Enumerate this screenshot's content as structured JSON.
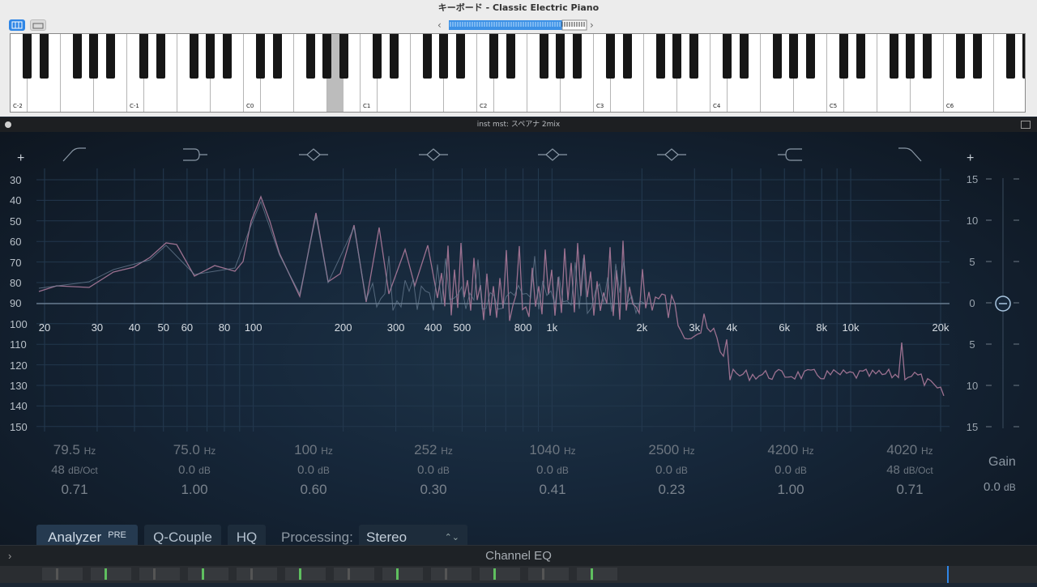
{
  "keyboard_window": {
    "title": "キーボード - Classic Electric Piano",
    "octave_labels": [
      "C-2",
      "C-1",
      "C0",
      "C1",
      "C2",
      "C3",
      "C4",
      "C5",
      "C6"
    ],
    "nav_prev": "‹",
    "nav_next": "›"
  },
  "plugin_window": {
    "title": "inst mst: スペアナ 2mix",
    "plus_left": "+",
    "plus_right": "+"
  },
  "eq": {
    "db_scale_left": [
      "30",
      "40",
      "50",
      "60",
      "70",
      "80",
      "90",
      "100",
      "110",
      "120",
      "130",
      "140",
      "150"
    ],
    "gain_scale_right": [
      "15",
      "10",
      "5",
      "0",
      "5",
      "10",
      "15"
    ],
    "freq_labels": [
      "20",
      "30",
      "40",
      "50",
      "60",
      "80",
      "100",
      "200",
      "300",
      "400",
      "500",
      "800",
      "1k",
      "2k",
      "3k",
      "4k",
      "6k",
      "8k",
      "10k",
      "20k"
    ],
    "bands": [
      {
        "freq": "79.5",
        "freq_unit": "Hz",
        "slope": "48",
        "slope_unit": "dB/Oct",
        "q": "0.71"
      },
      {
        "freq": "75.0",
        "freq_unit": "Hz",
        "slope": "0.0",
        "slope_unit": "dB",
        "q": "1.00"
      },
      {
        "freq": "100",
        "freq_unit": "Hz",
        "slope": "0.0",
        "slope_unit": "dB",
        "q": "0.60"
      },
      {
        "freq": "252",
        "freq_unit": "Hz",
        "slope": "0.0",
        "slope_unit": "dB",
        "q": "0.30"
      },
      {
        "freq": "1040",
        "freq_unit": "Hz",
        "slope": "0.0",
        "slope_unit": "dB",
        "q": "0.41"
      },
      {
        "freq": "2500",
        "freq_unit": "Hz",
        "slope": "0.0",
        "slope_unit": "dB",
        "q": "0.23"
      },
      {
        "freq": "4200",
        "freq_unit": "Hz",
        "slope": "0.0",
        "slope_unit": "dB",
        "q": "1.00"
      },
      {
        "freq": "4020",
        "freq_unit": "Hz",
        "slope": "48",
        "slope_unit": "dB/Oct",
        "q": "0.71"
      }
    ],
    "gain_label": "Gain",
    "gain_value": "0.0",
    "gain_unit": "dB"
  },
  "controls": {
    "analyzer": "Analyzer",
    "analyzer_badge": "PRE",
    "q_couple": "Q-Couple",
    "hq": "HQ",
    "processing_label": "Processing:",
    "processing_value": "Stereo"
  },
  "footer": {
    "title": "Channel EQ"
  },
  "colors": {
    "accent": "#2f86e6",
    "spectrum": "#a87c95",
    "background": "#16273a"
  }
}
